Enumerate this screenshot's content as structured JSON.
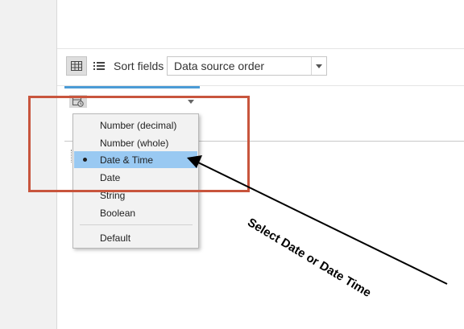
{
  "toolbar": {
    "grid_view_icon": "grid-icon",
    "list_view_icon": "list-icon",
    "sort_label": "Sort fields",
    "sort_value": "Data source order"
  },
  "column": {
    "type_icon": "calendar-clock-icon"
  },
  "type_menu": {
    "items": [
      {
        "label": "Number (decimal)",
        "selected": false
      },
      {
        "label": "Number (whole)",
        "selected": false
      },
      {
        "label": "Date & Time",
        "selected": true
      },
      {
        "label": "Date",
        "selected": false
      },
      {
        "label": "String",
        "selected": false
      },
      {
        "label": "Boolean",
        "selected": false
      },
      {
        "label": "Default",
        "selected": false
      }
    ]
  },
  "annotation": {
    "text": "Select Date or Date Time",
    "box_color": "#c8553d",
    "arrow_color": "#000000"
  },
  "colors": {
    "selected_item": "#99c9f2",
    "column_accent": "#4b9bd6"
  }
}
